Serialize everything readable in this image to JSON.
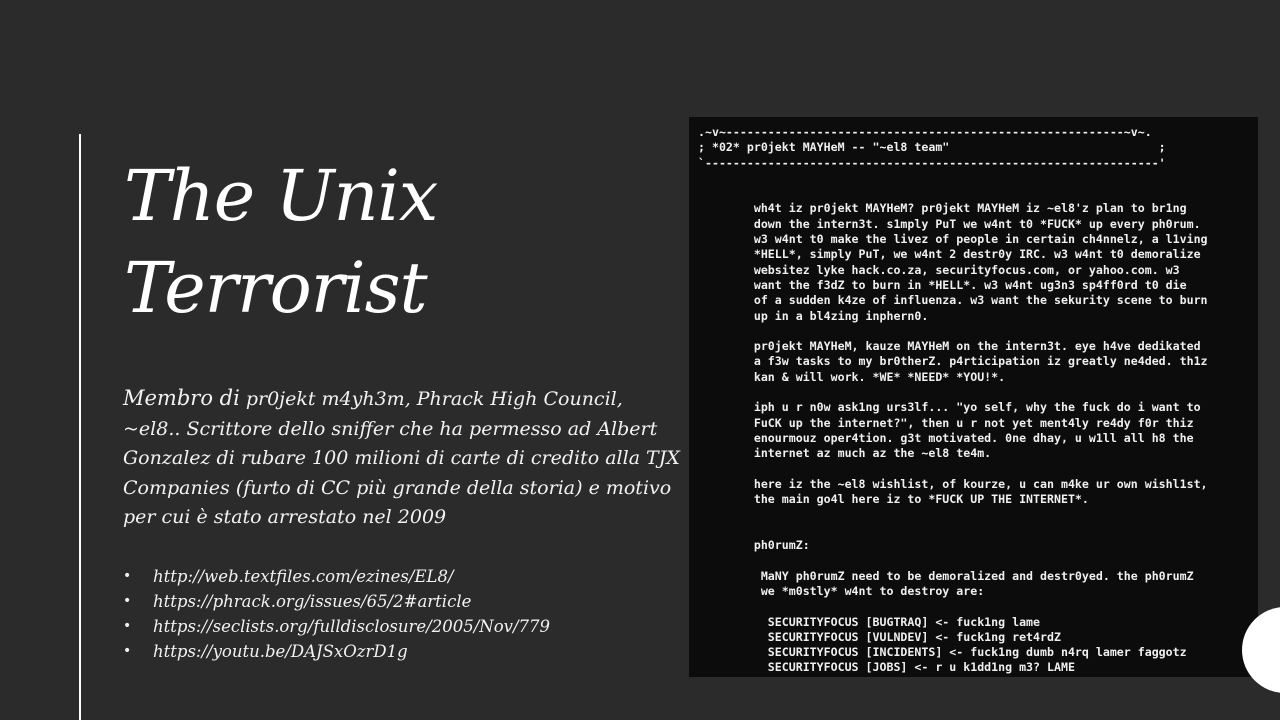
{
  "slide": {
    "title_line1": "The Unix",
    "title_line2": "Terrorist",
    "description_lead": "Membro di",
    "description_rest": " pr0jekt m4yh3m, Phrack High Council, ~el8.. Scrittore dello sniffer che ha permesso ad Albert Gonzalez di rubare 100 milioni di carte di credito alla TJX Companies (furto di CC più grande della storia) e motivo per cui è stato arrestato nel 2009",
    "bullet_glyph": "•",
    "links": [
      "http://web.textfiles.com/ezines/EL8/",
      "https://phrack.org/issues/65/2#article",
      "https://seclists.org/fulldisclosure/2005/Nov/779",
      "https://youtu.be/DAJSxOzrD1g"
    ]
  },
  "terminal": {
    "text": ".~v~---------------------------------------------------------~v~.\n; *02* pr0jekt MAYHeM -- \"~el8 team\"                              ;\n`-----------------------------------------------------------------'\n\n\n        wh4t iz pr0jekt MAYHeM? pr0jekt MAYHeM iz ~el8'z plan to br1ng\n        down the intern3t. s1mply PuT we w4nt t0 *FUCK* up every ph0rum.\n        w3 w4nt t0 make the livez of people in certain ch4nnelz, a l1ving\n        *HELL*, simply PuT, we w4nt 2 destr0y IRC. w3 w4nt t0 demoralize\n        websitez lyke hack.co.za, securityfocus.com, or yahoo.com. w3\n        want the f3dZ to burn in *HELL*. w3 w4nt ug3n3 sp4ff0rd t0 die\n        of a sudden k4ze of influenza. w3 want the sekurity scene to burn\n        up in a bl4zing inphern0.\n\n        pr0jekt MAYHeM, kauze MAYHeM on the intern3t. eye h4ve dedikated\n        a f3w tasks to my br0therZ. p4rticipation iz greatly ne4ded. th1z\n        kan & will work. *WE* *NEED* *YOU!*.\n\n        iph u r n0w ask1ng urs3lf... \"yo self, why the fuck do i want to\n        FuCK up the internet?\", then u r not yet ment4ly re4dy f0r thiz\n        enourmouz oper4tion. g3t motivated. 0ne dhay, u w1ll all h8 the\n        internet az much az the ~el8 te4m.\n\n        here iz the ~el8 wishlist, of kourze, u can m4ke ur own wishl1st,\n        the main go4l here iz to *FUCK UP THE INTERNET*.\n\n\n        ph0rumZ:\n\n         MaNY ph0rumZ need to be demoralized and destr0yed. the ph0rumZ\n         we *m0stly* w4nt to destroy are:\n\n          SECURITYFOCUS [BUGTRAQ] <- fuck1ng lame\n          SECURITYFOCUS [VULNDEV] <- fuck1ng ret4rdZ\n          SECURITYFOCUS [INCIDENTS] <- fuck1ng dumb n4rq lamer faggotz\n          SECURITYFOCUS [JOBS] <- r u k1dd1ng m3? LAME"
  }
}
